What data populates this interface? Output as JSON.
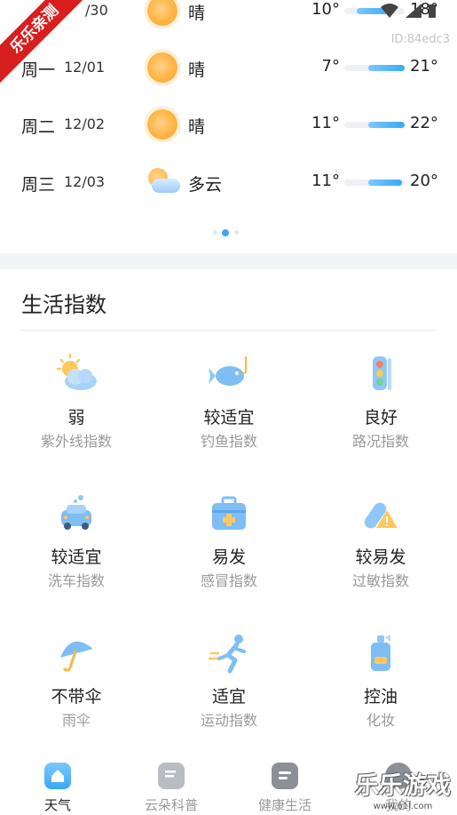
{
  "forecast": [
    {
      "day": "",
      "date": "/30",
      "icon": "sun-icon",
      "cond": "晴",
      "lo": "10°",
      "hi": "18°",
      "bar_start": 0.25,
      "bar_end": 0.85
    },
    {
      "day": "周一",
      "date": "12/01",
      "icon": "sun-icon",
      "cond": "晴",
      "lo": "7°",
      "hi": "21°",
      "bar_start": 0.4,
      "bar_end": 1.0
    },
    {
      "day": "周二",
      "date": "12/02",
      "icon": "sun-icon",
      "cond": "晴",
      "lo": "11°",
      "hi": "22°",
      "bar_start": 0.4,
      "bar_end": 1.0
    },
    {
      "day": "周三",
      "date": "12/03",
      "icon": "partly-cloudy-icon",
      "cond": "多云",
      "lo": "11°",
      "hi": "20°",
      "bar_start": 0.4,
      "bar_end": 0.9
    }
  ],
  "device_id": "ID:84edc3",
  "ribbon_text": "乐乐亲测",
  "life": {
    "title": "生活指数",
    "items": [
      {
        "value": "弱",
        "label": "紫外线指数",
        "icon": "uv-sun-cloud-icon"
      },
      {
        "value": "较适宜",
        "label": "钓鱼指数",
        "icon": "fish-icon"
      },
      {
        "value": "良好",
        "label": "路况指数",
        "icon": "traffic-light-icon"
      },
      {
        "value": "较适宜",
        "label": "洗车指数",
        "icon": "car-wash-icon"
      },
      {
        "value": "易发",
        "label": "感冒指数",
        "icon": "medical-kit-icon"
      },
      {
        "value": "较易发",
        "label": "过敏指数",
        "icon": "allergy-pill-icon"
      },
      {
        "value": "不带伞",
        "label": "雨伞",
        "icon": "umbrella-icon"
      },
      {
        "value": "适宜",
        "label": "运动指数",
        "icon": "running-icon"
      },
      {
        "value": "控油",
        "label": "化妆",
        "icon": "cosmetic-bottle-icon"
      }
    ]
  },
  "nav": [
    {
      "label": "天气",
      "icon": "home-weather-icon",
      "active": true
    },
    {
      "label": "云朵科普",
      "icon": "article-icon",
      "active": false
    },
    {
      "label": "健康生活",
      "icon": "health-card-icon",
      "active": false
    },
    {
      "label": "我的",
      "icon": "profile-icon",
      "active": false
    }
  ],
  "watermark": {
    "text": "乐乐游戏",
    "url": "www.61l.com"
  },
  "colors": {
    "accent": "#3aa8f3",
    "sun": "#ffb443",
    "ribbon": "#d81e1e",
    "muted": "#9a9a9a"
  }
}
